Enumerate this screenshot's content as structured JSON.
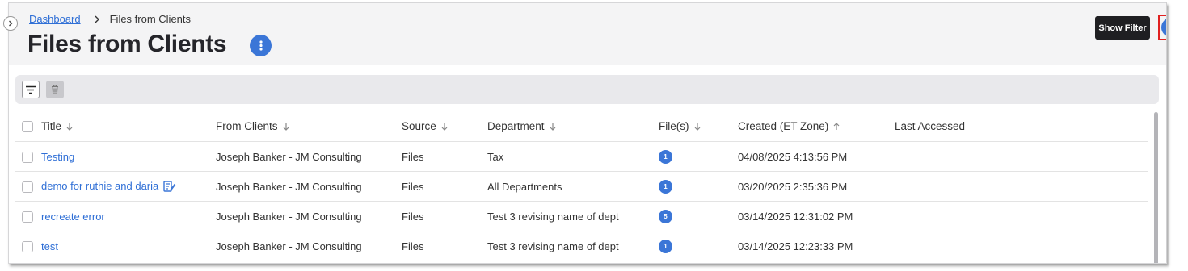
{
  "breadcrumb": {
    "link": "Dashboard",
    "current": "Files from Clients"
  },
  "page": {
    "title": "Files from Clients"
  },
  "actions": {
    "show_filter": "Show Filter"
  },
  "table": {
    "columns": [
      "Title",
      "From Clients",
      "Source",
      "Department",
      "File(s)",
      "Created (ET Zone)",
      "Last Accessed"
    ],
    "rows": [
      {
        "title": "Testing",
        "from": "Joseph Banker - JM Consulting",
        "source": "Files",
        "department": "Tax",
        "files": "1",
        "created": "04/08/2025 4:13:56 PM",
        "last_accessed": ""
      },
      {
        "title": "demo for ruthie and daria",
        "from": "Joseph Banker - JM Consulting",
        "source": "Files",
        "department": "All Departments",
        "files": "1",
        "created": "03/20/2025 2:35:36 PM",
        "last_accessed": ""
      },
      {
        "title": "recreate error",
        "from": "Joseph Banker - JM Consulting",
        "source": "Files",
        "department": "Test 3 revising name of dept",
        "files": "5",
        "created": "03/14/2025 12:31:02 PM",
        "last_accessed": ""
      },
      {
        "title": "test",
        "from": "Joseph Banker - JM Consulting",
        "source": "Files",
        "department": "Test 3 revising name of dept",
        "files": "1",
        "created": "03/14/2025 12:23:33 PM",
        "last_accessed": ""
      }
    ]
  },
  "icons": {
    "collapse": "chevron-right-icon",
    "title_menu": "more-vertical-icon",
    "back": "chevron-left-icon",
    "filter": "filter-lines-icon",
    "trash": "trash-icon",
    "edit": "edit-note-icon"
  },
  "colors": {
    "accent": "#3b76d7",
    "link": "#2f6fd6",
    "highlight": "#e02020",
    "dark_button": "#1f1f22"
  }
}
